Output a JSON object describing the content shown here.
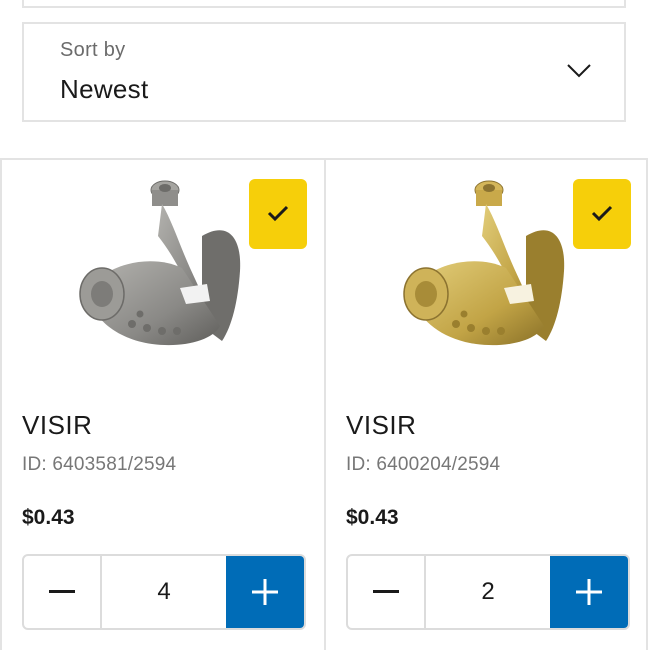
{
  "sort": {
    "label": "Sort by",
    "value": "Newest"
  },
  "products": [
    {
      "name": "VISIR",
      "id": "ID: 6403581/2594",
      "price": "$0.43",
      "quantity": "4",
      "selected": true,
      "color": "#8f8e8b"
    },
    {
      "name": "VISIR",
      "id": "ID: 6400204/2594",
      "price": "$0.43",
      "quantity": "2",
      "selected": true,
      "color": "#c9a94a"
    }
  ],
  "colors": {
    "accent_yellow": "#f6cf0a",
    "accent_blue": "#006cb7",
    "border": "#e3e3e3"
  }
}
